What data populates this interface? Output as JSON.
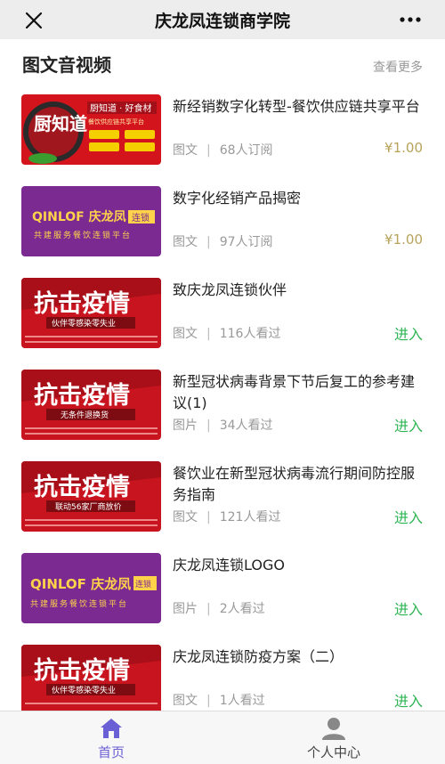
{
  "header": {
    "title": "庆龙凤连锁商学院",
    "close_icon": "close-icon",
    "more_icon": "more-dots-icon"
  },
  "section": {
    "title": "图文音视频",
    "see_more": "查看更多"
  },
  "items": [
    {
      "title": "新经销数字化转型-餐饮供应链共享平台",
      "type": "图文",
      "stat": "68人订阅",
      "action": "¥1.00",
      "thumb": {
        "kind": "kitchen",
        "big": "厨知道",
        "tagline": "厨知道 · 好食材",
        "sub": "餐饮供应链共享平台"
      }
    },
    {
      "title": "数字化经销产品揭密",
      "type": "图文",
      "stat": "97人订阅",
      "action": "¥1.00",
      "thumb": {
        "kind": "purple",
        "brand": "QINLOF 庆龙凤",
        "badge": "连锁",
        "sub": "共建服务餐饮连锁平台"
      }
    },
    {
      "title": "致庆龙凤连锁伙伴",
      "type": "图文",
      "stat": "116人看过",
      "action": "进入",
      "thumb": {
        "kind": "fight",
        "big": "抗击疫情",
        "band": "伙伴零感染零失业"
      }
    },
    {
      "title": "新型冠状病毒背景下节后复工的参考建议(1)",
      "type": "图片",
      "stat": "34人看过",
      "action": "进入",
      "thumb": {
        "kind": "fight",
        "big": "抗击疫情",
        "band": "无条件退换货"
      }
    },
    {
      "title": "餐饮业在新型冠状病毒流行期间防控服务指南",
      "type": "图文",
      "stat": "121人看过",
      "action": "进入",
      "thumb": {
        "kind": "fight",
        "big": "抗击疫情",
        "band": "联动56家厂商放价"
      }
    },
    {
      "title": "庆龙凤连锁LOGO",
      "type": "图片",
      "stat": "2人看过",
      "action": "进入",
      "thumb": {
        "kind": "purple2",
        "brand": "QINLOF 庆龙凤",
        "badge": "连锁",
        "sub": "共建服务餐饮连锁平台"
      }
    },
    {
      "title": "庆龙凤连锁防疫方案（二）",
      "type": "图文",
      "stat": "1人看过",
      "action": "进入",
      "thumb": {
        "kind": "fight",
        "big": "抗击疫情",
        "band": "伙伴零感染零失业"
      }
    }
  ],
  "tabbar": {
    "home_label": "首页",
    "me_label": "个人中心",
    "home_icon": "home-icon",
    "me_icon": "user-icon"
  },
  "colors": {
    "price": "#b8a35b",
    "enter": "#2fb554",
    "accent": "#6b5fd6",
    "poster_red": "#c8141e",
    "purple": "#7a2a91"
  }
}
